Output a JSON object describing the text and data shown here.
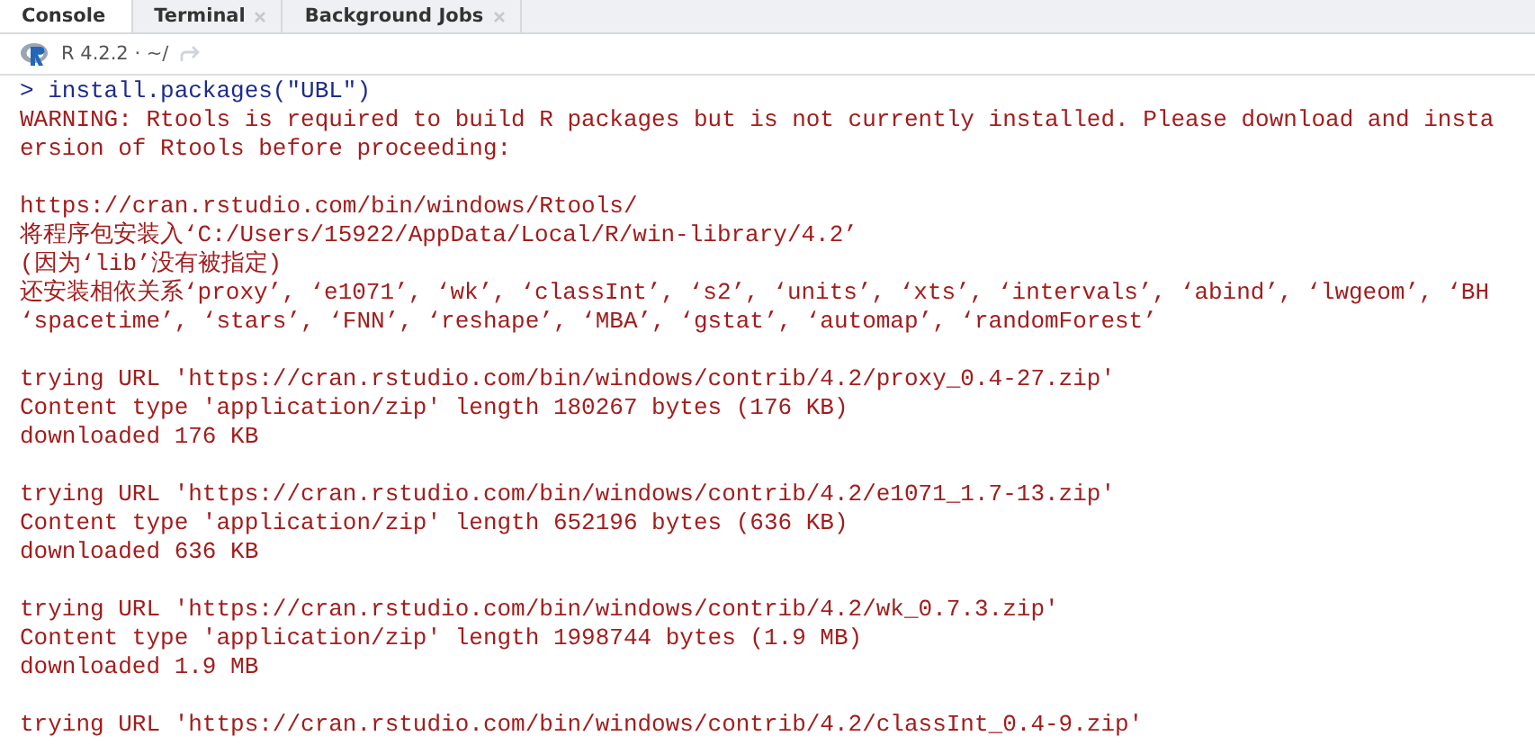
{
  "tabs": [
    {
      "label": "Console",
      "selected": true,
      "closable": false
    },
    {
      "label": "Terminal",
      "selected": false,
      "closable": true
    },
    {
      "label": "Background Jobs",
      "selected": false,
      "closable": true
    }
  ],
  "toolbar": {
    "version_path": "R 4.2.2 · ~/"
  },
  "console": [
    {
      "lines": [
        {
          "kind": "input",
          "text": "> install.packages(\"UBL\")"
        },
        {
          "kind": "message",
          "text": "WARNING: Rtools is required to build R packages but is not currently installed. Please download and insta"
        },
        {
          "kind": "message",
          "text": "ersion of Rtools before proceeding:"
        }
      ]
    },
    {
      "lines": [
        {
          "kind": "message",
          "text": "https://cran.rstudio.com/bin/windows/Rtools/"
        },
        {
          "kind": "message",
          "text": "将程序包安装入‘C:/Users/15922/AppData/Local/R/win-library/4.2’"
        },
        {
          "kind": "message",
          "text": "(因为‘lib’没有被指定)"
        },
        {
          "kind": "message",
          "text": "还安装相依关系‘proxy’, ‘e1071’, ‘wk’, ‘classInt’, ‘s2’, ‘units’, ‘xts’, ‘intervals’, ‘abind’, ‘lwgeom’, ‘BH"
        },
        {
          "kind": "message",
          "text": "‘spacetime’, ‘stars’, ‘FNN’, ‘reshape’, ‘MBA’, ‘gstat’, ‘automap’, ‘randomForest’"
        }
      ]
    },
    {
      "lines": [
        {
          "kind": "message",
          "text": "trying URL 'https://cran.rstudio.com/bin/windows/contrib/4.2/proxy_0.4-27.zip'"
        },
        {
          "kind": "message",
          "text": "Content type 'application/zip' length 180267 bytes (176 KB)"
        },
        {
          "kind": "message",
          "text": "downloaded 176 KB"
        }
      ]
    },
    {
      "lines": [
        {
          "kind": "message",
          "text": "trying URL 'https://cran.rstudio.com/bin/windows/contrib/4.2/e1071_1.7-13.zip'"
        },
        {
          "kind": "message",
          "text": "Content type 'application/zip' length 652196 bytes (636 KB)"
        },
        {
          "kind": "message",
          "text": "downloaded 636 KB"
        }
      ]
    },
    {
      "lines": [
        {
          "kind": "message",
          "text": "trying URL 'https://cran.rstudio.com/bin/windows/contrib/4.2/wk_0.7.3.zip'"
        },
        {
          "kind": "message",
          "text": "Content type 'application/zip' length 1998744 bytes (1.9 MB)"
        },
        {
          "kind": "message",
          "text": "downloaded 1.9 MB"
        }
      ]
    },
    {
      "lines": [
        {
          "kind": "message",
          "text": "trying URL 'https://cran.rstudio.com/bin/windows/contrib/4.2/classInt_0.4-9.zip'"
        }
      ]
    }
  ]
}
